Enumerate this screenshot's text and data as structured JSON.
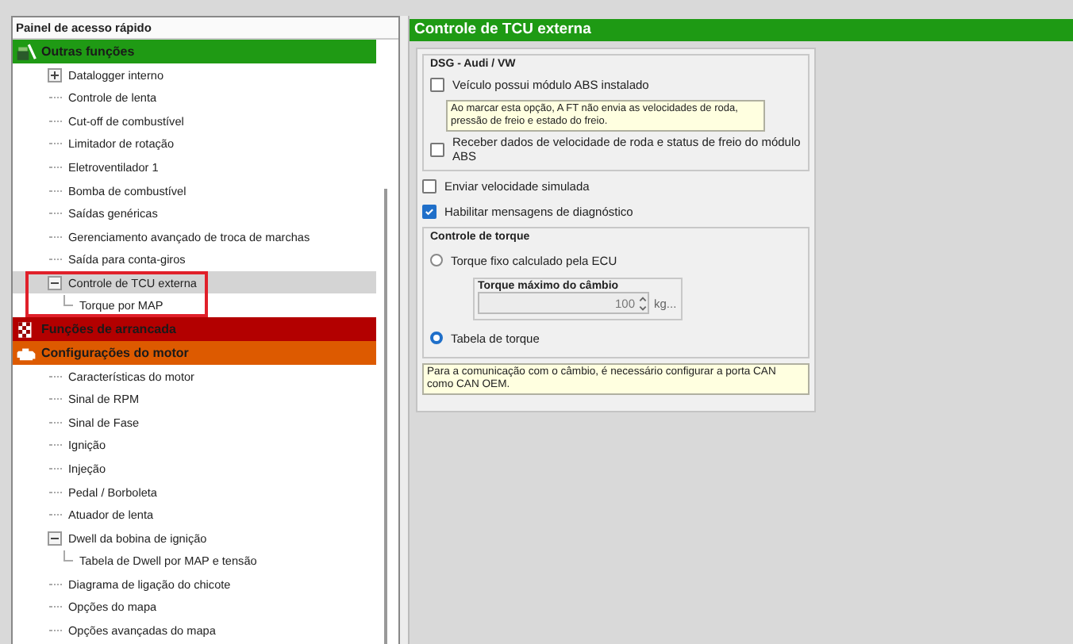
{
  "sidebar": {
    "title": "Painel de acesso rápido",
    "groups": [
      {
        "label": "Outras funções",
        "color": "#1f9a14",
        "items": [
          {
            "label": "Datalogger interno",
            "expanded": false
          },
          {
            "label": "Controle de lenta"
          },
          {
            "label": "Cut-off de combustível"
          },
          {
            "label": "Limitador de rotação"
          },
          {
            "label": "Eletroventilador 1"
          },
          {
            "label": "Bomba de combustível"
          },
          {
            "label": "Saídas genéricas"
          },
          {
            "label": "Gerenciamento avançado de troca de marchas"
          },
          {
            "label": "Saída para conta-giros"
          },
          {
            "label": "Controle de TCU externa",
            "expanded": true,
            "selected": true,
            "outlined": true,
            "children": [
              {
                "label": "Torque por MAP"
              }
            ]
          }
        ]
      },
      {
        "label": "Funções de arrancada",
        "color": "#b30000"
      },
      {
        "label": "Configurações do motor",
        "color": "#dd5a00",
        "items": [
          {
            "label": "Características do motor"
          },
          {
            "label": "Sinal de RPM"
          },
          {
            "label": "Sinal de Fase"
          },
          {
            "label": "Ignição"
          },
          {
            "label": "Injeção"
          },
          {
            "label": "Pedal / Borboleta"
          },
          {
            "label": "Atuador de lenta"
          },
          {
            "label": "Dwell da bobina de ignição",
            "expanded": true,
            "children": [
              {
                "label": "Tabela de Dwell por MAP e tensão"
              }
            ]
          },
          {
            "label": "Diagrama de ligação do chicote"
          },
          {
            "label": "Opções do mapa"
          },
          {
            "label": "Opções avançadas do mapa"
          }
        ]
      }
    ]
  },
  "panel": {
    "title": "Controle de TCU externa",
    "dsg_group": {
      "title": "DSG - Audi / VW",
      "abs_installed": {
        "label": "Veículo possui módulo ABS instalado",
        "checked": false
      },
      "abs_note": "Ao marcar esta opção, A FT não envia as velocidades de roda, pressão de freio e estado do freio.",
      "receive_abs": {
        "label": "Receber dados de velocidade de roda e status de freio do módulo ABS",
        "checked": false
      }
    },
    "simulated_speed": {
      "label": "Enviar velocidade simulada",
      "checked": false
    },
    "diagnostics": {
      "label": "Habilitar mensagens de diagnóstico",
      "checked": true
    },
    "torque_group": {
      "title": "Controle de torque",
      "options": [
        {
          "label": "Torque fixo calculado pela ECU",
          "selected": false,
          "max_torque": {
            "title": "Torque máximo do câmbio",
            "value": "100",
            "unit": "kg..."
          }
        },
        {
          "label": "Tabela de torque",
          "selected": true
        }
      ]
    },
    "can_note": "Para a comunicação com o câmbio, é necessário configurar a porta CAN como CAN OEM."
  }
}
